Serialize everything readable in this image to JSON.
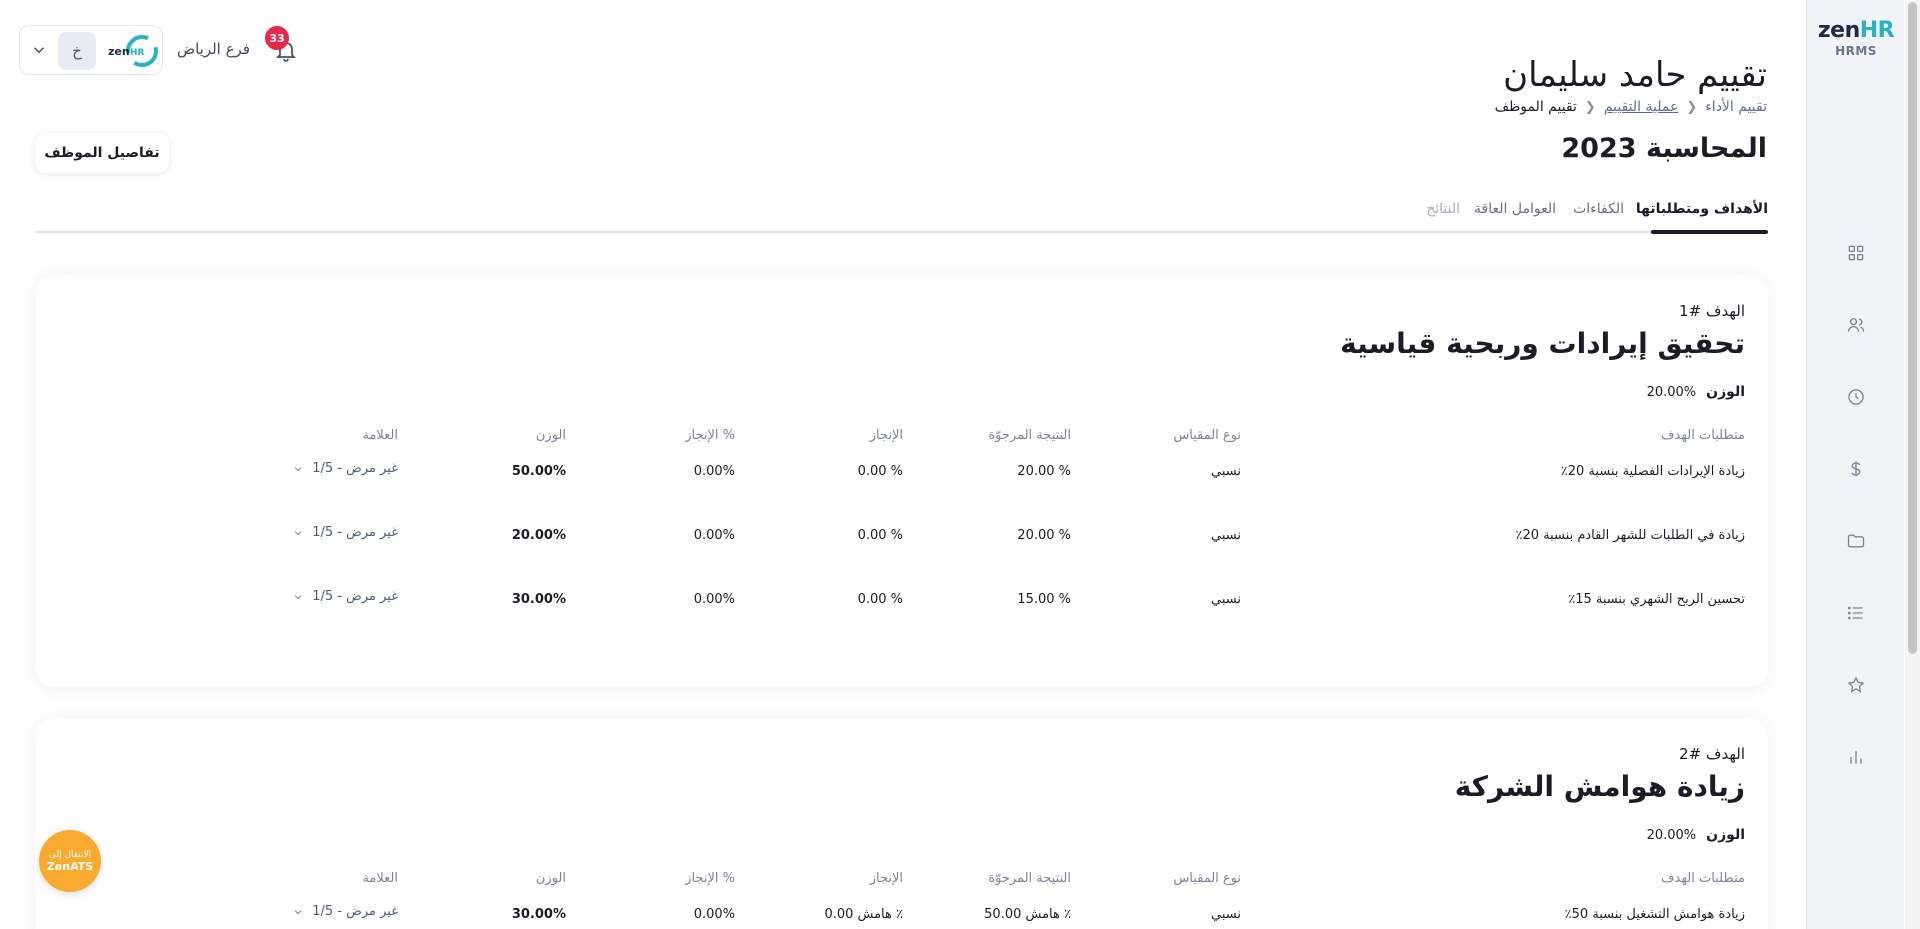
{
  "app": {
    "brand_main": "zen",
    "brand_accent": "HR",
    "brand_sub": "HRMS"
  },
  "header": {
    "notifications_count": "33",
    "branch": "فرع الرياض",
    "avatar_initial": "خ",
    "page_title": "تقييم حامد سليمان",
    "breadcrumb": [
      "تقييم الأداء",
      "عملية التقييم",
      "تقييم الموظف"
    ],
    "sub_title": "المحاسبة 2023",
    "details_button": "تفاصيل الموظف"
  },
  "tabs": [
    "الأهداف ومتطلباتها",
    "الكفاءات",
    "العوامل العاقة",
    "النتائج"
  ],
  "columns": [
    "متطلبات الهدف",
    "نوع المقياس",
    "النتيجة المرجوّة",
    "الإنجاز",
    "الإنجاز %",
    "الوزن",
    "العلامة"
  ],
  "goals": [
    {
      "num": "الهدف #1",
      "title": "تحقيق إيرادات وربحية قياسية",
      "weight_label": "الوزن",
      "weight": "20.00%",
      "rows": [
        {
          "req": "زيادة الإيرادات الفصلية بنسبة 20٪",
          "type": "نسبي",
          "target": "20.00 %",
          "achieved": "0.00 %",
          "pct": "0.00%",
          "weight": "50.00%",
          "grade": "1/5 - غير مرض"
        },
        {
          "req": "زيادة في الطلبات للشهر القادم بنسبة 20٪",
          "type": "نسبي",
          "target": "20.00 %",
          "achieved": "0.00 %",
          "pct": "0.00%",
          "weight": "20.00%",
          "grade": "1/5 - غير مرض"
        },
        {
          "req": "تحسين الربح الشهري بنسبة 15٪",
          "type": "نسبي",
          "target": "15.00 %",
          "achieved": "0.00 %",
          "pct": "0.00%",
          "weight": "30.00%",
          "grade": "1/5 - غير مرض"
        }
      ]
    },
    {
      "num": "الهدف #2",
      "title": "زيادة هوامش الشركة",
      "weight_label": "الوزن",
      "weight": "20.00%",
      "rows": [
        {
          "req": "زيادة هوامش التشغيل بنسبة 50٪",
          "type": "نسبي",
          "target": "50.00 هامش ٪",
          "achieved": "0.00 هامش ٪",
          "pct": "0.00%",
          "weight": "30.00%",
          "grade": "1/5 - غير مرض"
        }
      ]
    }
  ],
  "ats": {
    "line1": "الانتقال إلى",
    "line2": "ZenATS"
  },
  "colors": {
    "accent": "#27b3c5",
    "badge": "#e5294a",
    "ats": "#f9ab2f"
  }
}
